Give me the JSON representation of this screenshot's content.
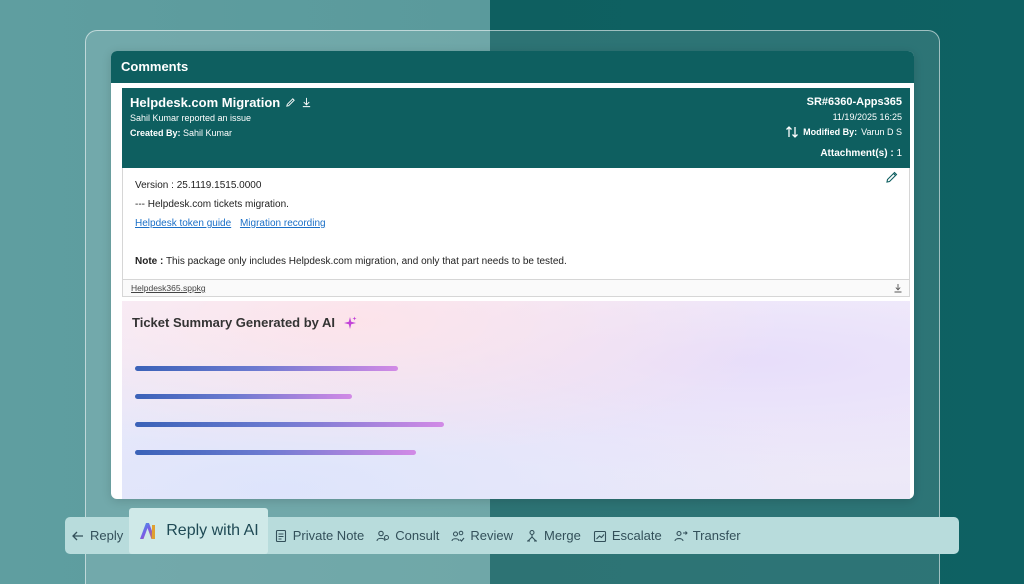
{
  "panel": {
    "title": "Comments"
  },
  "ticket": {
    "title": "Helpdesk.com Migration",
    "reported": "Sahil Kumar reported an issue",
    "created_label": "Created By:",
    "created_by": "Sahil Kumar",
    "sr_number": "SR#6360-Apps365",
    "date": "11/19/2025 16:25",
    "modified_label": "Modified By:",
    "modified_by": "Varun D S",
    "attachments_label": "Attachment(s) :",
    "attachments_count": "1"
  },
  "comment": {
    "version": "Version : 25.1119.1515.0000",
    "line2": "--- Helpdesk.com tickets migration.",
    "links": [
      "Helpdesk token guide",
      "Migration recording"
    ],
    "note_label": "Note :",
    "note_text": "This package only includes Helpdesk.com migration, and only that part needs to be tested."
  },
  "attachment": {
    "filename": "Helpdesk365.sppkg"
  },
  "ai_summary": {
    "title": "Ticket Summary Generated by AI",
    "placeholder_lines": 4
  },
  "actions": [
    {
      "label": "Reply",
      "icon": "arrow-left-icon"
    },
    {
      "label": "Reply with AI",
      "icon": "ai-logo-icon",
      "highlighted": true
    },
    {
      "label": "Private Note",
      "icon": "note-icon"
    },
    {
      "label": "Consult",
      "icon": "people-icon"
    },
    {
      "label": "Review",
      "icon": "people-check-icon"
    },
    {
      "label": "Merge",
      "icon": "merge-icon"
    },
    {
      "label": "Escalate",
      "icon": "escalate-icon"
    },
    {
      "label": "Transfer",
      "icon": "transfer-icon"
    }
  ],
  "colors": {
    "brand": "#0e5f60",
    "link": "#1a6fc7",
    "action_bar": "#b8dcdc"
  }
}
